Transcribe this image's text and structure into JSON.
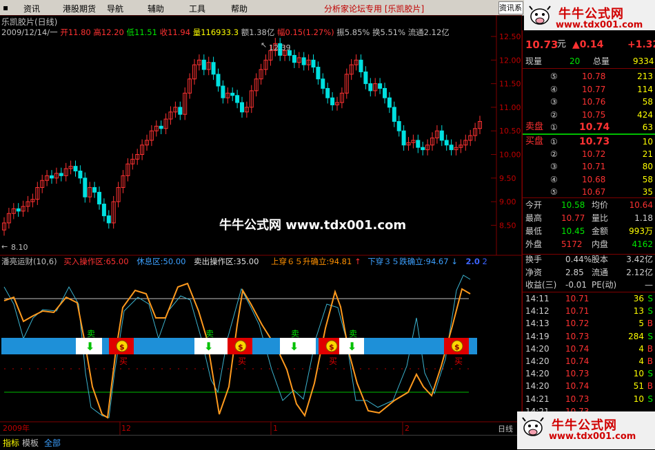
{
  "menu": [
    "资讯",
    "港股期货",
    "导航",
    "辅助",
    "工具",
    "帮助"
  ],
  "app_title": "分析家论坛专用 [乐凯胶片]",
  "search_button": "资讯系",
  "logo": {
    "name": "牛牛公式网",
    "url": "www.tdx001.com"
  },
  "watermark": "牛牛公式网 www.tdx001.com",
  "chart_title": "乐凯胶片(日线)",
  "info_bar": {
    "date": "2009/12/14/一",
    "open_label": "开",
    "open": "11.80",
    "high_label": "高",
    "high": "12.20",
    "low_label": "低",
    "low": "11.51",
    "close_label": "收",
    "close": "11.94",
    "volume_label": "量",
    "volume": "116933.3",
    "amount_label": "额",
    "amount": "1.38亿",
    "change_label": "幅",
    "change": "0.15(1.27%)",
    "amplitude": "振5.85%",
    "turnover": "换5.51%",
    "float": "流通2.12亿"
  },
  "price_axis": [
    "12.50",
    "12.00",
    "11.50",
    "11.00",
    "10.50",
    "10.00",
    "9.50",
    "9.00",
    "8.50"
  ],
  "price_max_label": "12.39",
  "price_min_label": "8.10",
  "indicator": {
    "name": "潘亮运财(10,6)",
    "buy_zone": "买入操作区:65.00",
    "rest_zone": "休息区:50.00",
    "sell_zone": "卖出操作区:35.00",
    "up_cross": "上穿６５升确立:94.81",
    "up_arrow": "↑",
    "down_cross": "下穿３５跌确立:94.67",
    "down_arrow": "↓",
    "last_a": "2.0",
    "last_b": "2",
    "signal_sell": "卖",
    "signal_buy": "买"
  },
  "time_axis": [
    "2009年",
    "12",
    "1",
    "2"
  ],
  "period_label": "日线",
  "quote": {
    "price": "10.73",
    "unit": "元",
    "change": "▲0.14",
    "change_pct": "+1.32",
    "now_vol_label": "现量",
    "now_vol": "20",
    "total_vol_label": "总量",
    "total_vol": "9334",
    "ask_label": "卖盘",
    "bid_label": "买盘",
    "asks": [
      {
        "lvl": "⑤",
        "price": "10.78",
        "vol": "213"
      },
      {
        "lvl": "④",
        "price": "10.77",
        "vol": "114"
      },
      {
        "lvl": "③",
        "price": "10.76",
        "vol": "58"
      },
      {
        "lvl": "②",
        "price": "10.75",
        "vol": "424"
      },
      {
        "lvl": "①",
        "price": "10.74",
        "vol": "63"
      }
    ],
    "bids": [
      {
        "lvl": "①",
        "price": "10.73",
        "vol": "10"
      },
      {
        "lvl": "②",
        "price": "10.72",
        "vol": "21"
      },
      {
        "lvl": "③",
        "price": "10.71",
        "vol": "80"
      },
      {
        "lvl": "④",
        "price": "10.68",
        "vol": "58"
      },
      {
        "lvl": "⑤",
        "price": "10.67",
        "vol": "35"
      }
    ],
    "stats": [
      {
        "l1": "今开",
        "v1": "10.58",
        "c1": "grn",
        "l2": "均价",
        "v2": "10.64",
        "c2": "red"
      },
      {
        "l1": "最高",
        "v1": "10.77",
        "c1": "red",
        "l2": "量比",
        "v2": "1.18",
        "c2": "wht"
      },
      {
        "l1": "最低",
        "v1": "10.45",
        "c1": "grn",
        "l2": "金额",
        "v2": "993万",
        "c2": "yel"
      },
      {
        "l1": "外盘",
        "v1": "5172",
        "c1": "red",
        "l2": "内盘",
        "v2": "4162",
        "c2": "grn"
      }
    ],
    "fund": [
      {
        "l1": "换手",
        "v1": "0.44%",
        "l2": "股本",
        "v2": "3.42亿"
      },
      {
        "l1": "净资",
        "v1": "2.85",
        "l2": "流通",
        "v2": "2.12亿"
      },
      {
        "l1": "收益(三)",
        "v1": "-0.01",
        "l2": "PE(动)",
        "v2": "—"
      }
    ],
    "ticks": [
      {
        "t": "14:11",
        "p": "10.71",
        "v": "36",
        "s": "S"
      },
      {
        "t": "14:12",
        "p": "10.71",
        "v": "13",
        "s": "S"
      },
      {
        "t": "14:13",
        "p": "10.72",
        "v": "5",
        "s": "B"
      },
      {
        "t": "14:19",
        "p": "10.73",
        "v": "284",
        "s": "S"
      },
      {
        "t": "14:20",
        "p": "10.74",
        "v": "4",
        "s": "B"
      },
      {
        "t": "14:20",
        "p": "10.74",
        "v": "4",
        "s": "B"
      },
      {
        "t": "14:20",
        "p": "10.73",
        "v": "10",
        "s": "S"
      },
      {
        "t": "14:20",
        "p": "10.74",
        "v": "51",
        "s": "B"
      },
      {
        "t": "14:21",
        "p": "10.73",
        "v": "10",
        "s": "S"
      },
      {
        "t": "14:21",
        "p": "10.73",
        "v": "",
        "s": ""
      }
    ]
  },
  "status_tabs": [
    "指标",
    "模板",
    "全部"
  ]
}
